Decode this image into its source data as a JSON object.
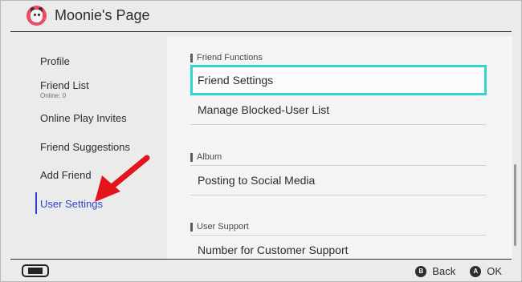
{
  "header": {
    "title": "Moonie's Page",
    "avatar_icon": "villager-avatar-icon"
  },
  "sidebar": {
    "items": [
      {
        "label": "Profile",
        "sub": ""
      },
      {
        "label": "Friend List",
        "sub": "Online: 0"
      },
      {
        "label": "Online Play Invites",
        "sub": ""
      },
      {
        "label": "Friend Suggestions",
        "sub": ""
      },
      {
        "label": "Add Friend",
        "sub": ""
      },
      {
        "label": "User Settings",
        "sub": "",
        "active": true
      }
    ]
  },
  "main": {
    "sections": [
      {
        "label": "Friend Functions",
        "rows": [
          "Friend Settings",
          "Manage Blocked-User List"
        ]
      },
      {
        "label": "Album",
        "rows": [
          "Posting to Social Media"
        ]
      },
      {
        "label": "User Support",
        "rows": [
          "Number for Customer Support"
        ]
      }
    ],
    "selected_row": "Friend Settings"
  },
  "footer": {
    "console_icon": "handheld-console-icon",
    "back": {
      "glyph": "B",
      "label": "Back"
    },
    "ok": {
      "glyph": "A",
      "label": "OK"
    }
  },
  "colors": {
    "accent": "#2e45c9",
    "selection": "#33d6cc",
    "annotation": "#e3141b",
    "avatar_bg": "#e94c63"
  }
}
